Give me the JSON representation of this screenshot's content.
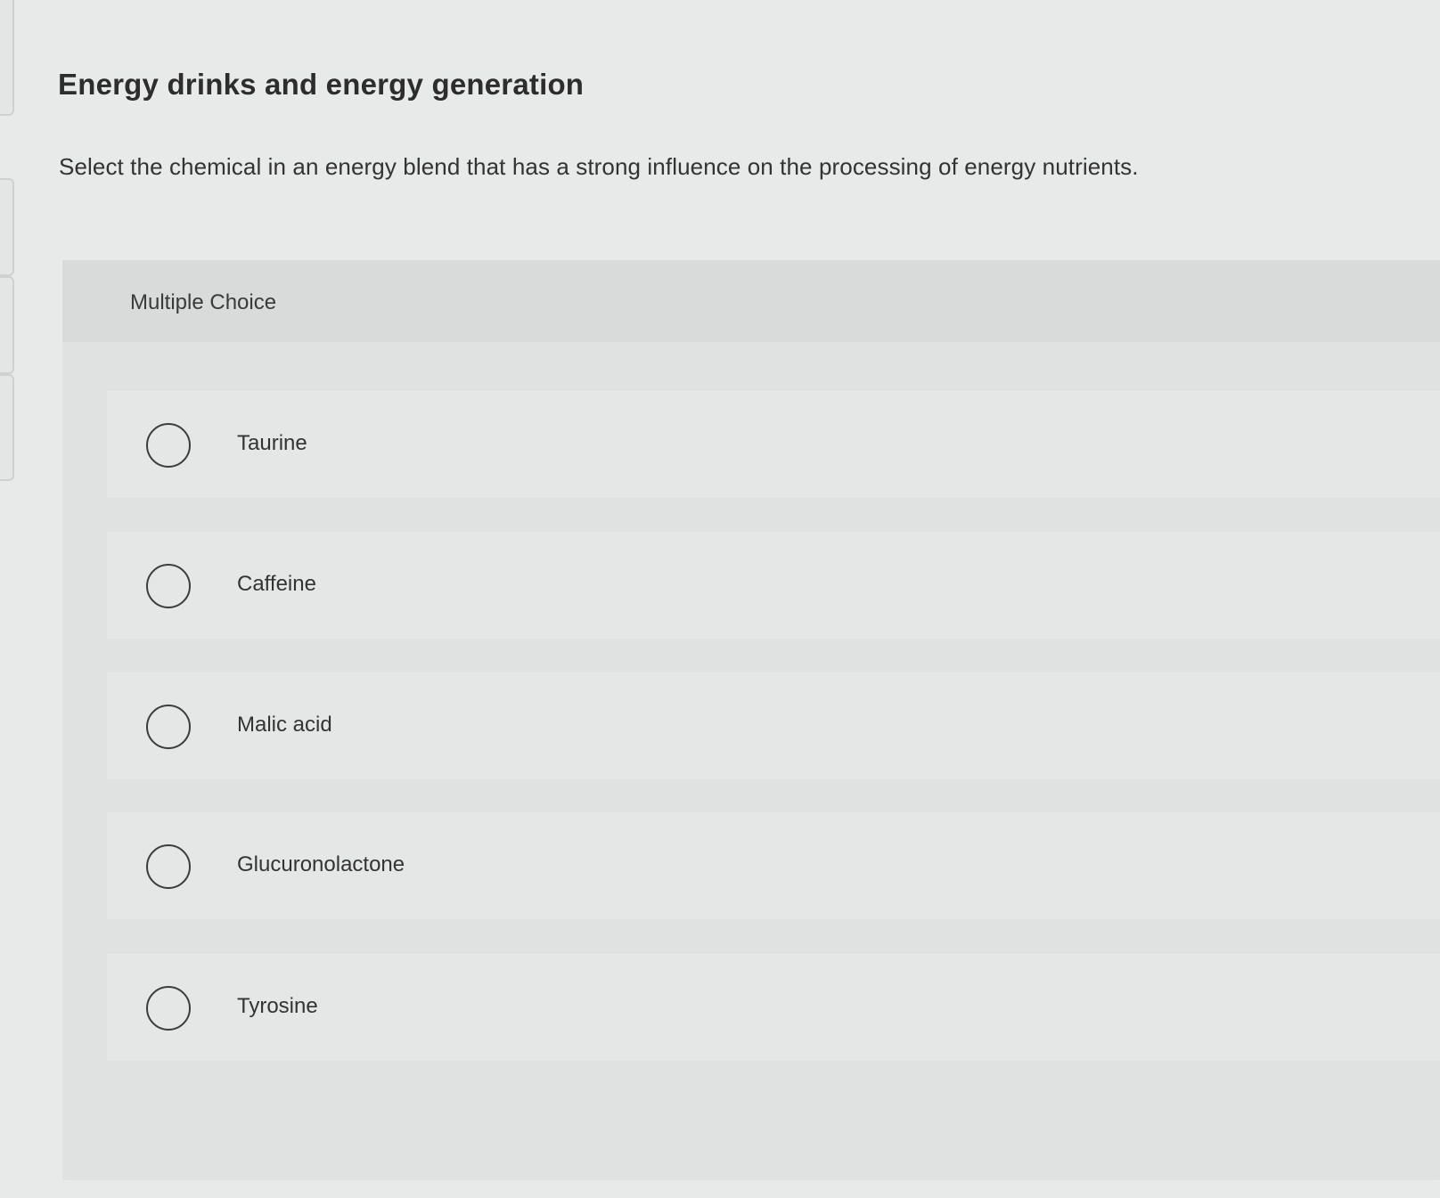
{
  "question": {
    "title": "Energy drinks and energy generation",
    "prompt": "Select the chemical in an energy blend that has a strong influence on the processing of energy nutrients."
  },
  "multiple_choice": {
    "label": "Multiple Choice",
    "options": [
      {
        "label": "Taurine",
        "selected": false
      },
      {
        "label": "Caffeine",
        "selected": false
      },
      {
        "label": "Malic acid",
        "selected": false
      },
      {
        "label": "Glucuronolactone",
        "selected": false
      },
      {
        "label": "Tyrosine",
        "selected": false
      }
    ]
  }
}
